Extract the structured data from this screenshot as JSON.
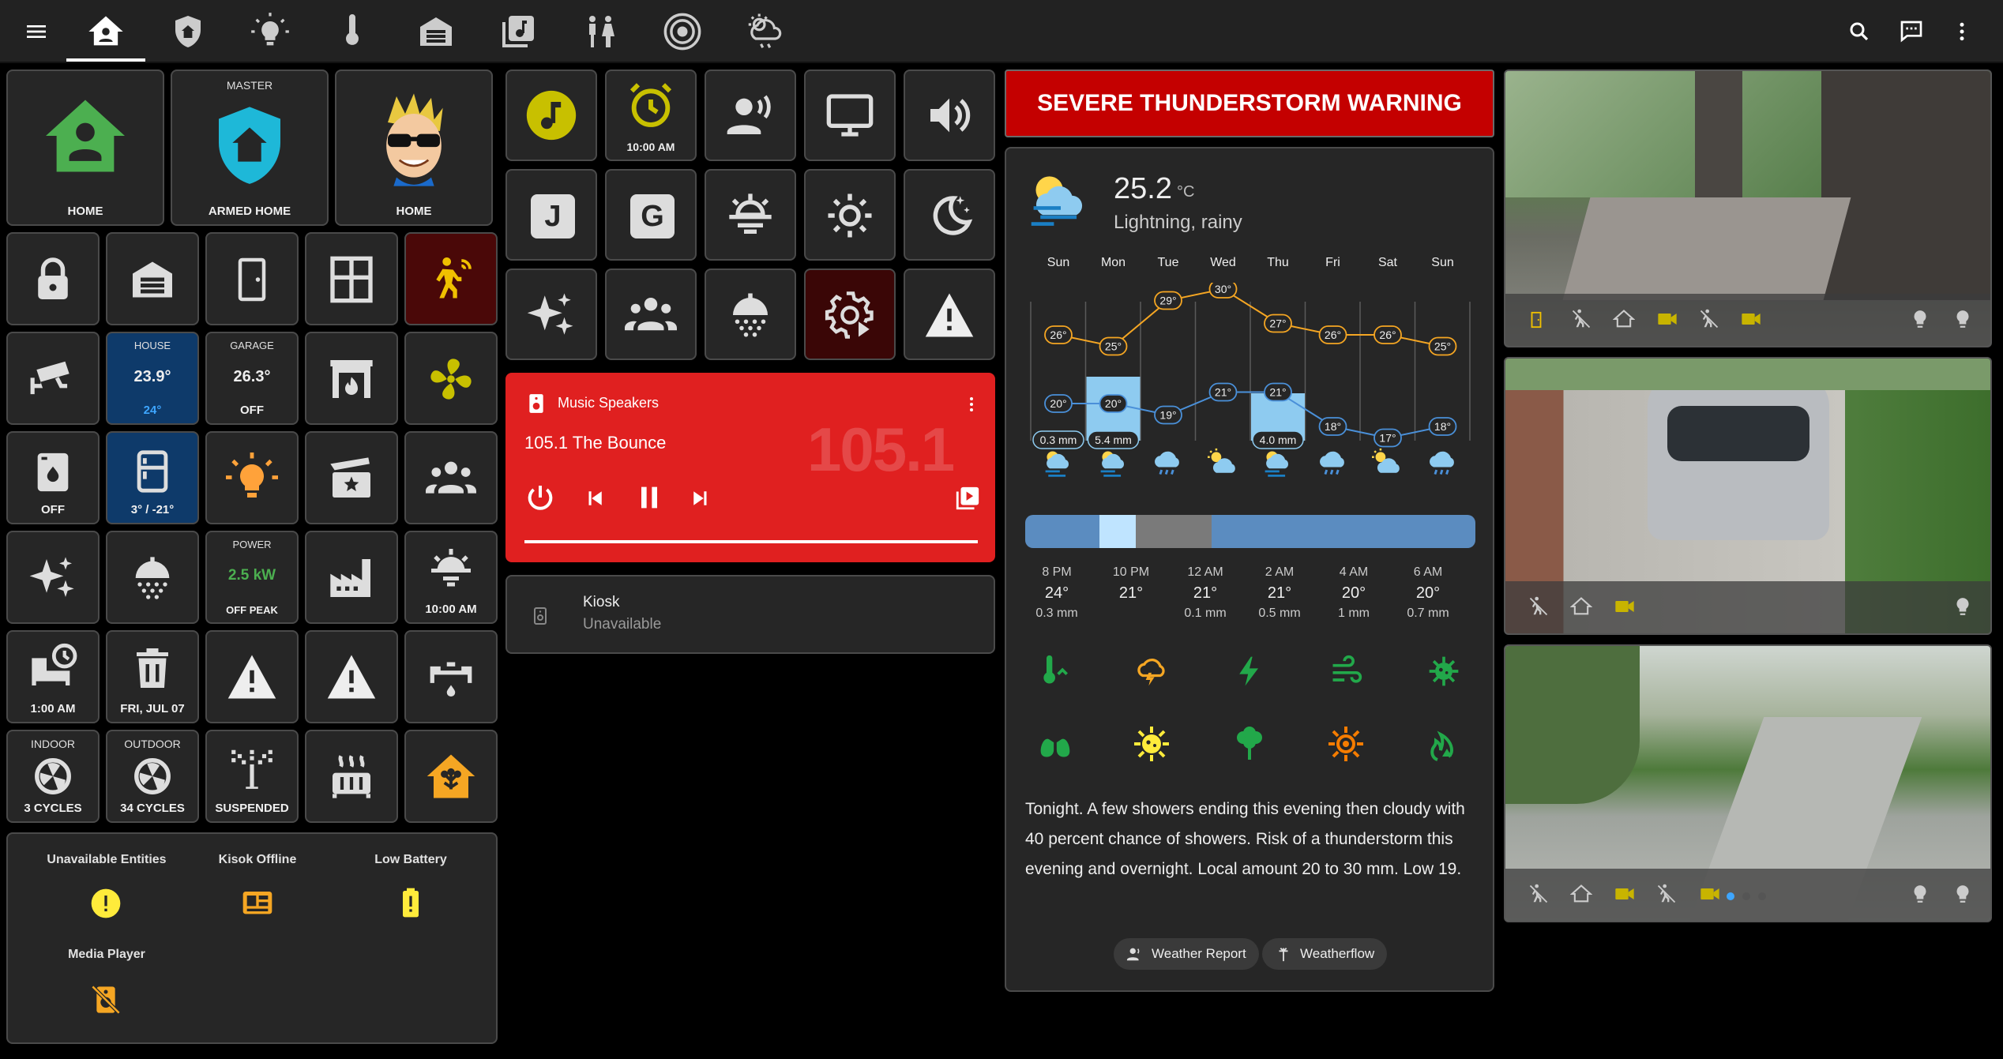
{
  "colors": {
    "accent_green": "#4caf50",
    "warning_red": "#c40000",
    "music_red": "#e02020",
    "amber": "#f5a623",
    "cyan": "#1eb8d8"
  },
  "topbar": {
    "icons": [
      "menu-icon",
      "home-icon",
      "shield-home-icon",
      "lightbulb-icon",
      "thermometer-icon",
      "garage-icon",
      "music-library-icon",
      "human-male-female-icon",
      "speaker-icon",
      "weather-icon",
      "search-icon",
      "chat-icon",
      "dots-vertical-icon"
    ]
  },
  "security": {
    "home": {
      "label": "HOME"
    },
    "master": {
      "top": "MASTER",
      "label": "ARMED HOME"
    },
    "person": {
      "label": "HOME"
    }
  },
  "tiles": {
    "house": {
      "top": "HOUSE",
      "value": "23.9°",
      "sub": "24°"
    },
    "garage": {
      "top": "GARAGE",
      "value": "26.3°",
      "sub": "OFF"
    },
    "washer": {
      "label": "OFF"
    },
    "fridge": {
      "label": "3° / -21°"
    },
    "power": {
      "top": "POWER",
      "value": "2.5 kW",
      "sub": "OFF PEAK"
    },
    "sunrise": {
      "label": "10:00 AM"
    },
    "sleep": {
      "label": "1:00 AM"
    },
    "trash": {
      "label": "FRI, JUL 07"
    },
    "indoor": {
      "top": "INDOOR",
      "label": "3 CYCLES"
    },
    "outdoor": {
      "top": "OUTDOOR",
      "label": "34 CYCLES"
    },
    "sprinkler": {
      "label": "SUSPENDED"
    },
    "alarm": {
      "label": "10:00 AM"
    },
    "letter_j": "J",
    "letter_g": "G"
  },
  "alerts": {
    "unavailable": "Unavailable Entities",
    "kiosk": "Kisok Offline",
    "battery": "Low Battery",
    "media": "Media Player"
  },
  "music": {
    "title": "Music Speakers",
    "station": "105.1 The Bounce",
    "art_text": "105.1"
  },
  "kiosk": {
    "name": "Kiosk",
    "state": "Unavailable"
  },
  "warning": {
    "text": "SEVERE THUNDERSTORM WARNING"
  },
  "weather": {
    "temp": "25.2",
    "unit": "°C",
    "condition": "Lightning, rainy",
    "days": [
      "Sun",
      "Mon",
      "Tue",
      "Wed",
      "Thu",
      "Fri",
      "Sat",
      "Sun"
    ],
    "highs": [
      26,
      25,
      29,
      30,
      27,
      26,
      26,
      25
    ],
    "lows": [
      20,
      20,
      19,
      21,
      21,
      18,
      17,
      18
    ],
    "precip": [
      "0.3 mm",
      "5.4 mm",
      "",
      "",
      "4.0 mm",
      "",
      "",
      ""
    ],
    "precip_values": [
      0.3,
      5.4,
      0,
      0,
      4.0,
      0,
      0,
      0
    ],
    "hours": [
      {
        "time": "8 PM",
        "temp": "24°",
        "rain": "0.3 mm"
      },
      {
        "time": "10 PM",
        "temp": "21°",
        "rain": ""
      },
      {
        "time": "12 AM",
        "temp": "21°",
        "rain": "0.1 mm"
      },
      {
        "time": "2 AM",
        "temp": "21°",
        "rain": "0.5 mm"
      },
      {
        "time": "4 AM",
        "temp": "20°",
        "rain": "1 mm"
      },
      {
        "time": "6 AM",
        "temp": "20°",
        "rain": "0.7 mm"
      }
    ],
    "forecast": "Tonight. A few showers ending this evening then cloudy with 40 percent chance of showers. Risk of a thunderstorm this evening and overnight. Local amount 20 to 30 mm. Low 19.",
    "chips": [
      "Weather Report",
      "Weatherflow"
    ]
  }
}
